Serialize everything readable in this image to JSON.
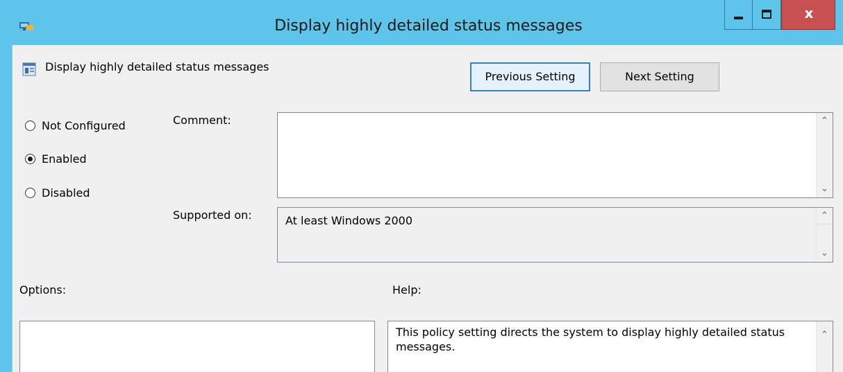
{
  "window": {
    "title": "Display highly detailed status messages",
    "close_glyph": "x"
  },
  "header": {
    "setting_name": "Display highly detailed status messages",
    "previous_label": "Previous Setting",
    "next_label": "Next Setting"
  },
  "state": {
    "options": [
      "Not Configured",
      "Enabled",
      "Disabled"
    ],
    "selected": "Enabled"
  },
  "comment": {
    "label": "Comment:",
    "value": ""
  },
  "supported": {
    "label": "Supported on:",
    "value": "At least Windows 2000"
  },
  "options_pane": {
    "label": "Options:"
  },
  "help_pane": {
    "label": "Help:",
    "text": "This policy setting directs the system to display highly detailed status messages."
  },
  "icons": {
    "window": "group-policy-app-icon",
    "setting": "policy-setting-icon",
    "scroll_up": "chevron-up-icon",
    "scroll_down": "chevron-down-icon"
  },
  "colors": {
    "titlebar": "#5ec4e9",
    "close_button": "#c75050",
    "panel": "#f0f0f0",
    "focus_border": "#3c7fb1"
  }
}
